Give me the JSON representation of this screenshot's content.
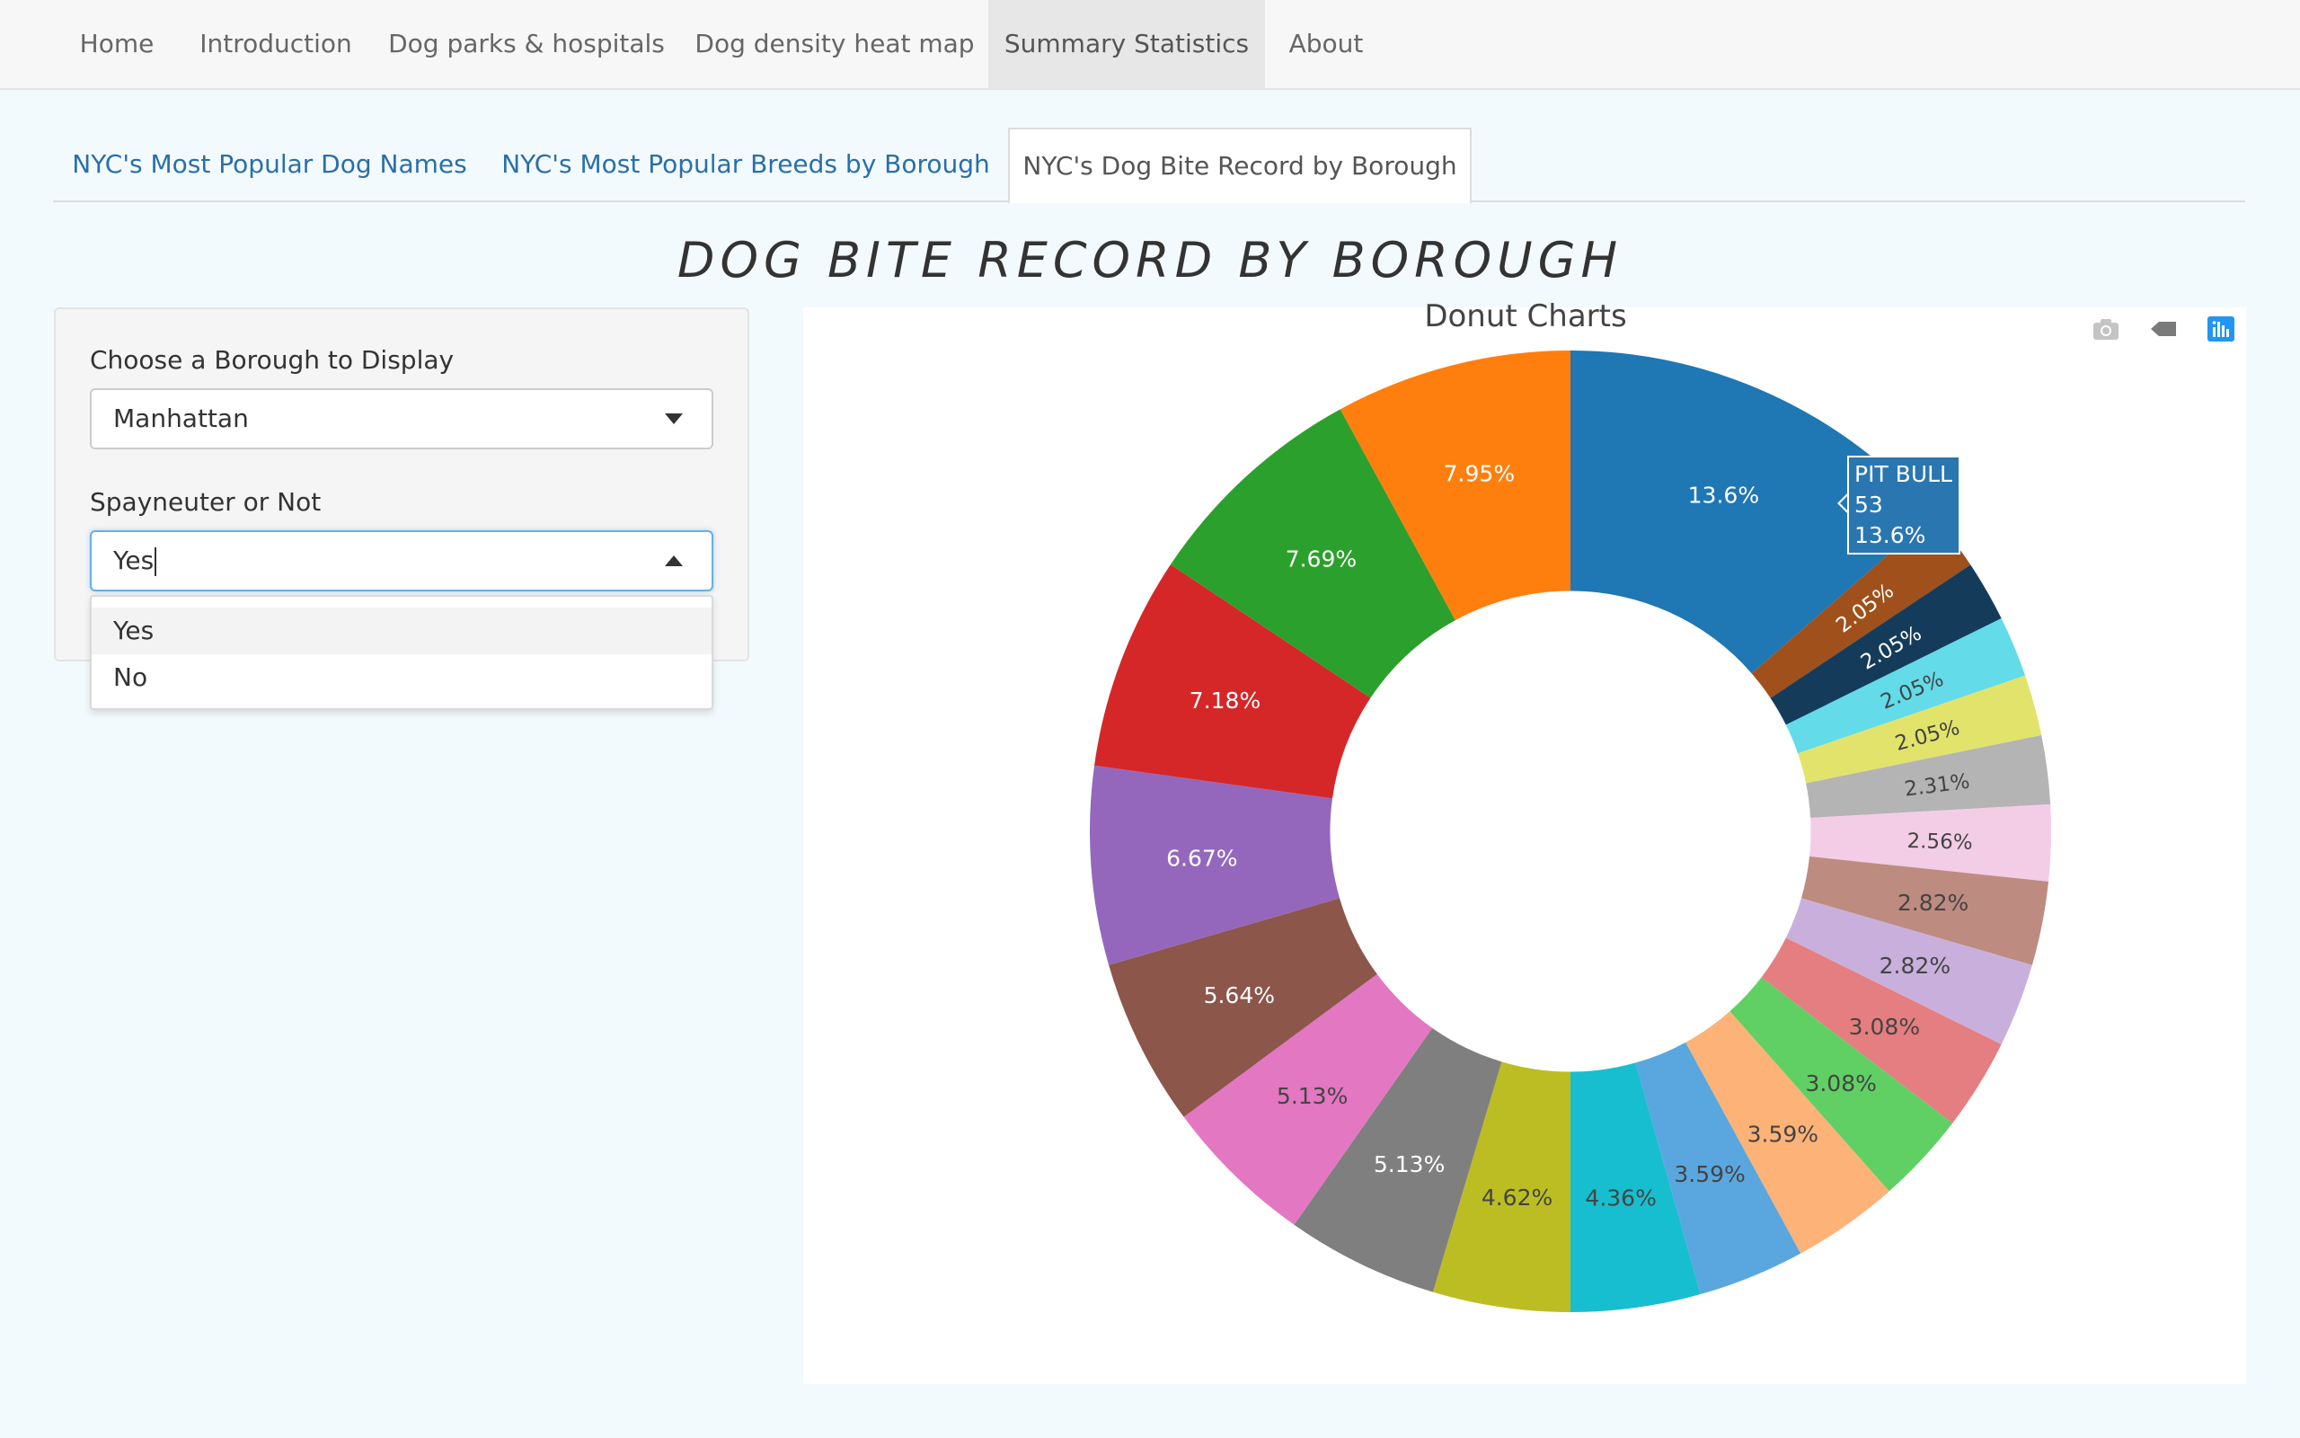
{
  "nav": {
    "items": [
      {
        "label": "Home"
      },
      {
        "label": "Introduction"
      },
      {
        "label": "Dog parks & hospitals"
      },
      {
        "label": "Dog density heat map"
      },
      {
        "label": "Summary Statistics"
      },
      {
        "label": "About"
      }
    ],
    "active_index": 4
  },
  "tabs": {
    "items": [
      {
        "label": "NYC's Most Popular Dog Names"
      },
      {
        "label": "NYC's Most Popular Breeds by Borough"
      },
      {
        "label": "NYC's Dog Bite Record by Borough"
      }
    ],
    "active_index": 2
  },
  "page_title": "DOG BITE RECORD BY BOROUGH",
  "panel": {
    "borough_label": "Choose a Borough to Display",
    "borough_value": "Manhattan",
    "spay_label": "Spayneuter or Not",
    "spay_value": "Yes",
    "spay_options": [
      "Yes",
      "No"
    ]
  },
  "modebar": {
    "icons": [
      "camera-icon",
      "tag-icon",
      "plotly-logo-icon"
    ]
  },
  "colors": {
    "link": "#2a6fa8",
    "focus": "#66afe9"
  },
  "chart_data": {
    "type": "pie",
    "hole": 0.5,
    "title": "Donut Charts",
    "slices": [
      {
        "label": "PIT BULL",
        "value": 53,
        "percent_text": "13.6%",
        "color": "#1f77b4"
      },
      {
        "label": "",
        "percent_text": "2.05%",
        "color": "#a0501a"
      },
      {
        "label": "",
        "percent_text": "2.05%",
        "color": "#143c5a"
      },
      {
        "label": "",
        "percent_text": "2.05%",
        "color": "#63dbe9"
      },
      {
        "label": "",
        "percent_text": "2.05%",
        "color": "#e2e36b"
      },
      {
        "label": "",
        "percent_text": "2.31%",
        "color": "#b4b4b4"
      },
      {
        "label": "",
        "percent_text": "2.56%",
        "color": "#f3cde6"
      },
      {
        "label": "",
        "percent_text": "2.82%",
        "color": "#bd8b80"
      },
      {
        "label": "",
        "percent_text": "2.82%",
        "color": "#c9b0dc"
      },
      {
        "label": "",
        "percent_text": "3.08%",
        "color": "#e57e80"
      },
      {
        "label": "",
        "percent_text": "3.08%",
        "color": "#60d064"
      },
      {
        "label": "",
        "percent_text": "3.59%",
        "color": "#fdb277"
      },
      {
        "label": "",
        "percent_text": "3.59%",
        "color": "#5aa7df"
      },
      {
        "label": "",
        "percent_text": "4.36%",
        "color": "#17becf"
      },
      {
        "label": "",
        "percent_text": "4.62%",
        "color": "#bcbd22"
      },
      {
        "label": "",
        "percent_text": "5.13%",
        "color": "#7f7f7f"
      },
      {
        "label": "",
        "percent_text": "5.13%",
        "color": "#e377c2"
      },
      {
        "label": "",
        "percent_text": "5.64%",
        "color": "#8c564b"
      },
      {
        "label": "",
        "percent_text": "6.67%",
        "color": "#9467bd"
      },
      {
        "label": "",
        "percent_text": "7.18%",
        "color": "#d62728"
      },
      {
        "label": "",
        "percent_text": "7.69%",
        "color": "#2ca02c"
      },
      {
        "label": "",
        "percent_text": "7.95%",
        "color": "#ff7f0e"
      }
    ],
    "direction": "clockwise",
    "text_colors_light": [
      "#1f77b4",
      "#a0501a",
      "#143c5a",
      "#d62728",
      "#2ca02c",
      "#9467bd",
      "#8c564b",
      "#7f7f7f",
      "#ff7f0e"
    ],
    "hover": {
      "label": "PIT BULL",
      "count": "53",
      "percent": "13.6%"
    }
  }
}
